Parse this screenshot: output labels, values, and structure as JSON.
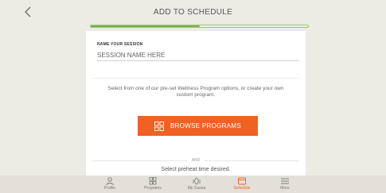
{
  "header": {
    "title": "ADD TO SCHEDULE",
    "back_icon": "chevron-left-icon"
  },
  "progress": {
    "fraction": 0.5,
    "fill_color": "#79b24a"
  },
  "form": {
    "session_label": "NAME YOUR SESSION",
    "session_placeholder": "SESSION NAME HERE",
    "description": "Select from one of our pre-set Wellness Program options, or create your own custom program.",
    "browse_label": "BROWSE PROGRAMS",
    "browse_icon": "grid-icon",
    "and_text": "AND",
    "preheat_text": "Select preheat time desired."
  },
  "colors": {
    "accent": "#ef6224",
    "background": "#ecebe4",
    "tabbar": "#e2e0d8"
  },
  "tabbar": {
    "active": "Schedule",
    "items": [
      {
        "label": "Profile",
        "icon": "person-icon"
      },
      {
        "label": "Programs",
        "icon": "grid-icon"
      },
      {
        "label": "My Sauna",
        "icon": "sauna-icon"
      },
      {
        "label": "Schedule",
        "icon": "calendar-icon"
      },
      {
        "label": "More",
        "icon": "menu-icon"
      }
    ]
  }
}
